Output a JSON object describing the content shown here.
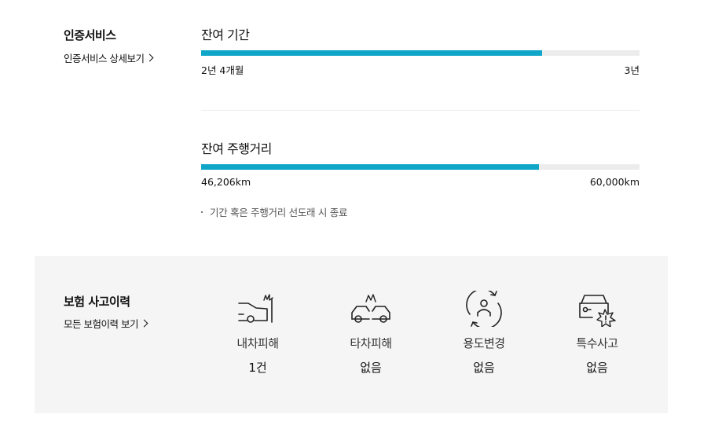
{
  "certification": {
    "title": "인증서비스",
    "detail_link": "인증서비스 상세보기"
  },
  "remaining_period": {
    "label": "잔여 기간",
    "current": "2년 4개월",
    "max": "3년",
    "progress_percent": 77.8
  },
  "remaining_mileage": {
    "label": "잔여 주행거리",
    "current": "46,206km",
    "max": "60,000km",
    "progress_percent": 77
  },
  "note": "기간 혹은 주행거리 선도래 시 종료",
  "insurance": {
    "title": "보험 사고이력",
    "detail_link": "모든 보험이력 보기",
    "items": [
      {
        "name": "내차피해",
        "value": "1건",
        "icon": "my-car-damage-icon"
      },
      {
        "name": "타차피해",
        "value": "없음",
        "icon": "other-car-damage-icon"
      },
      {
        "name": "용도변경",
        "value": "없음",
        "icon": "usage-change-icon"
      },
      {
        "name": "특수사고",
        "value": "없음",
        "icon": "special-accident-icon"
      }
    ]
  },
  "colors": {
    "accent": "#0fa6c8",
    "track": "#ececec",
    "panel": "#f5f5f5"
  }
}
